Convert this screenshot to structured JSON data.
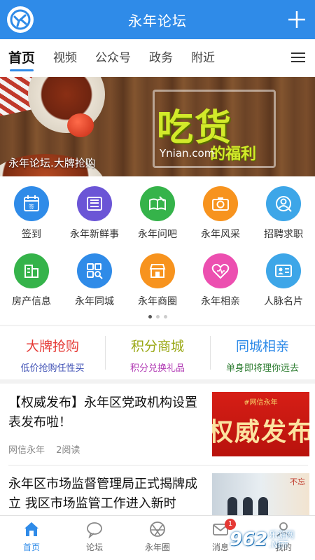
{
  "header": {
    "title": "永年论坛",
    "logo_icon": "app-logo-icon",
    "plus_icon": "plus-icon",
    "color": "#2f8be8"
  },
  "tabs": [
    {
      "label": "首页",
      "active": true
    },
    {
      "label": "视频",
      "active": false
    },
    {
      "label": "公众号",
      "active": false
    },
    {
      "label": "政务",
      "active": false
    },
    {
      "label": "附近",
      "active": false
    }
  ],
  "banner": {
    "headline": "吃货",
    "subline": "的福利",
    "site": "Ynian.com",
    "caption": "永年论坛.大牌抢购"
  },
  "grid": {
    "row1": [
      {
        "label": "签到",
        "icon": "sign-in-icon",
        "color": "#2f8be8"
      },
      {
        "label": "永年新鲜事",
        "icon": "news-icon",
        "color": "#6b55d6"
      },
      {
        "label": "永年问吧",
        "icon": "book-icon",
        "color": "#35b34a"
      },
      {
        "label": "永年风采",
        "icon": "camera-icon",
        "color": "#f7931e"
      },
      {
        "label": "招聘求职",
        "icon": "search-person-icon",
        "color": "#3da6e8"
      }
    ],
    "row2": [
      {
        "label": "房产信息",
        "icon": "building-icon",
        "color": "#35b34a"
      },
      {
        "label": "永年同城",
        "icon": "grid-search-icon",
        "color": "#2f8be8"
      },
      {
        "label": "永年商圈",
        "icon": "shop-icon",
        "color": "#f7931e"
      },
      {
        "label": "永年相亲",
        "icon": "heart-icon",
        "color": "#ec4fb0"
      },
      {
        "label": "人脉名片",
        "icon": "card-icon",
        "color": "#3da6e8"
      }
    ]
  },
  "promo": [
    {
      "title": "大牌抢购",
      "sub": "低价抢购任性买",
      "title_color": "#e53935",
      "sub_color": "#3f51b5"
    },
    {
      "title": "积分商城",
      "sub": "积分兑换礼品",
      "title_color": "#9aa815",
      "sub_color": "#b23cb5"
    },
    {
      "title": "同城相亲",
      "sub": "单身即将理你远去",
      "title_color": "#2f8be8",
      "sub_color": "#2e7d32"
    }
  ],
  "news": [
    {
      "title": "【权威发布】永年区党政机构设置表发布啦！",
      "source": "网信永年",
      "reads": "2阅读",
      "img_top": "#网信永年",
      "img_text": "权威发布"
    },
    {
      "title": "永年区市场监督管理局正式揭牌成立 我区市场监管工作进入新时",
      "img_text": "不忘"
    }
  ],
  "bottom_nav": [
    {
      "label": "首页",
      "icon": "home-icon",
      "active": true
    },
    {
      "label": "论坛",
      "icon": "chat-bubble-icon",
      "active": false
    },
    {
      "label": "永年圈",
      "icon": "aperture-icon",
      "active": false
    },
    {
      "label": "消息",
      "icon": "mail-icon",
      "active": false,
      "badge": "1"
    },
    {
      "label": "我的",
      "icon": "user-icon",
      "active": false
    }
  ],
  "watermark": {
    "num": "962",
    "text_top": "乐游网",
    "text_bottom": ".NET"
  }
}
